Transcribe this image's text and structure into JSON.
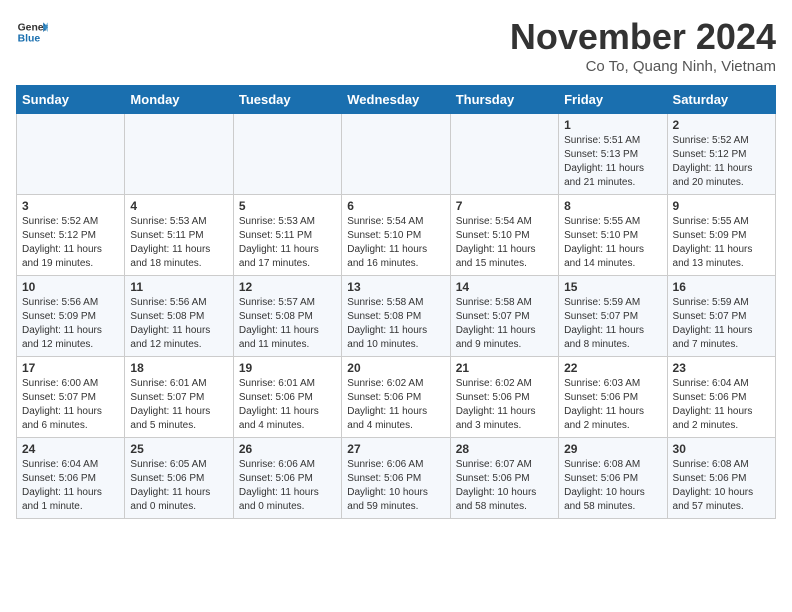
{
  "header": {
    "logo_general": "General",
    "logo_blue": "Blue",
    "month_title": "November 2024",
    "location": "Co To, Quang Ninh, Vietnam"
  },
  "days_of_week": [
    "Sunday",
    "Monday",
    "Tuesday",
    "Wednesday",
    "Thursday",
    "Friday",
    "Saturday"
  ],
  "weeks": [
    [
      {
        "day": "",
        "sunrise": "",
        "sunset": "",
        "daylight": "",
        "empty": true
      },
      {
        "day": "",
        "sunrise": "",
        "sunset": "",
        "daylight": "",
        "empty": true
      },
      {
        "day": "",
        "sunrise": "",
        "sunset": "",
        "daylight": "",
        "empty": true
      },
      {
        "day": "",
        "sunrise": "",
        "sunset": "",
        "daylight": "",
        "empty": true
      },
      {
        "day": "",
        "sunrise": "",
        "sunset": "",
        "daylight": "",
        "empty": true
      },
      {
        "day": "1",
        "sunrise": "Sunrise: 5:51 AM",
        "sunset": "Sunset: 5:13 PM",
        "daylight": "Daylight: 11 hours and 21 minutes."
      },
      {
        "day": "2",
        "sunrise": "Sunrise: 5:52 AM",
        "sunset": "Sunset: 5:12 PM",
        "daylight": "Daylight: 11 hours and 20 minutes."
      }
    ],
    [
      {
        "day": "3",
        "sunrise": "Sunrise: 5:52 AM",
        "sunset": "Sunset: 5:12 PM",
        "daylight": "Daylight: 11 hours and 19 minutes."
      },
      {
        "day": "4",
        "sunrise": "Sunrise: 5:53 AM",
        "sunset": "Sunset: 5:11 PM",
        "daylight": "Daylight: 11 hours and 18 minutes."
      },
      {
        "day": "5",
        "sunrise": "Sunrise: 5:53 AM",
        "sunset": "Sunset: 5:11 PM",
        "daylight": "Daylight: 11 hours and 17 minutes."
      },
      {
        "day": "6",
        "sunrise": "Sunrise: 5:54 AM",
        "sunset": "Sunset: 5:10 PM",
        "daylight": "Daylight: 11 hours and 16 minutes."
      },
      {
        "day": "7",
        "sunrise": "Sunrise: 5:54 AM",
        "sunset": "Sunset: 5:10 PM",
        "daylight": "Daylight: 11 hours and 15 minutes."
      },
      {
        "day": "8",
        "sunrise": "Sunrise: 5:55 AM",
        "sunset": "Sunset: 5:10 PM",
        "daylight": "Daylight: 11 hours and 14 minutes."
      },
      {
        "day": "9",
        "sunrise": "Sunrise: 5:55 AM",
        "sunset": "Sunset: 5:09 PM",
        "daylight": "Daylight: 11 hours and 13 minutes."
      }
    ],
    [
      {
        "day": "10",
        "sunrise": "Sunrise: 5:56 AM",
        "sunset": "Sunset: 5:09 PM",
        "daylight": "Daylight: 11 hours and 12 minutes."
      },
      {
        "day": "11",
        "sunrise": "Sunrise: 5:56 AM",
        "sunset": "Sunset: 5:08 PM",
        "daylight": "Daylight: 11 hours and 12 minutes."
      },
      {
        "day": "12",
        "sunrise": "Sunrise: 5:57 AM",
        "sunset": "Sunset: 5:08 PM",
        "daylight": "Daylight: 11 hours and 11 minutes."
      },
      {
        "day": "13",
        "sunrise": "Sunrise: 5:58 AM",
        "sunset": "Sunset: 5:08 PM",
        "daylight": "Daylight: 11 hours and 10 minutes."
      },
      {
        "day": "14",
        "sunrise": "Sunrise: 5:58 AM",
        "sunset": "Sunset: 5:07 PM",
        "daylight": "Daylight: 11 hours and 9 minutes."
      },
      {
        "day": "15",
        "sunrise": "Sunrise: 5:59 AM",
        "sunset": "Sunset: 5:07 PM",
        "daylight": "Daylight: 11 hours and 8 minutes."
      },
      {
        "day": "16",
        "sunrise": "Sunrise: 5:59 AM",
        "sunset": "Sunset: 5:07 PM",
        "daylight": "Daylight: 11 hours and 7 minutes."
      }
    ],
    [
      {
        "day": "17",
        "sunrise": "Sunrise: 6:00 AM",
        "sunset": "Sunset: 5:07 PM",
        "daylight": "Daylight: 11 hours and 6 minutes."
      },
      {
        "day": "18",
        "sunrise": "Sunrise: 6:01 AM",
        "sunset": "Sunset: 5:07 PM",
        "daylight": "Daylight: 11 hours and 5 minutes."
      },
      {
        "day": "19",
        "sunrise": "Sunrise: 6:01 AM",
        "sunset": "Sunset: 5:06 PM",
        "daylight": "Daylight: 11 hours and 4 minutes."
      },
      {
        "day": "20",
        "sunrise": "Sunrise: 6:02 AM",
        "sunset": "Sunset: 5:06 PM",
        "daylight": "Daylight: 11 hours and 4 minutes."
      },
      {
        "day": "21",
        "sunrise": "Sunrise: 6:02 AM",
        "sunset": "Sunset: 5:06 PM",
        "daylight": "Daylight: 11 hours and 3 minutes."
      },
      {
        "day": "22",
        "sunrise": "Sunrise: 6:03 AM",
        "sunset": "Sunset: 5:06 PM",
        "daylight": "Daylight: 11 hours and 2 minutes."
      },
      {
        "day": "23",
        "sunrise": "Sunrise: 6:04 AM",
        "sunset": "Sunset: 5:06 PM",
        "daylight": "Daylight: 11 hours and 2 minutes."
      }
    ],
    [
      {
        "day": "24",
        "sunrise": "Sunrise: 6:04 AM",
        "sunset": "Sunset: 5:06 PM",
        "daylight": "Daylight: 11 hours and 1 minute."
      },
      {
        "day": "25",
        "sunrise": "Sunrise: 6:05 AM",
        "sunset": "Sunset: 5:06 PM",
        "daylight": "Daylight: 11 hours and 0 minutes."
      },
      {
        "day": "26",
        "sunrise": "Sunrise: 6:06 AM",
        "sunset": "Sunset: 5:06 PM",
        "daylight": "Daylight: 11 hours and 0 minutes."
      },
      {
        "day": "27",
        "sunrise": "Sunrise: 6:06 AM",
        "sunset": "Sunset: 5:06 PM",
        "daylight": "Daylight: 10 hours and 59 minutes."
      },
      {
        "day": "28",
        "sunrise": "Sunrise: 6:07 AM",
        "sunset": "Sunset: 5:06 PM",
        "daylight": "Daylight: 10 hours and 58 minutes."
      },
      {
        "day": "29",
        "sunrise": "Sunrise: 6:08 AM",
        "sunset": "Sunset: 5:06 PM",
        "daylight": "Daylight: 10 hours and 58 minutes."
      },
      {
        "day": "30",
        "sunrise": "Sunrise: 6:08 AM",
        "sunset": "Sunset: 5:06 PM",
        "daylight": "Daylight: 10 hours and 57 minutes."
      }
    ]
  ]
}
